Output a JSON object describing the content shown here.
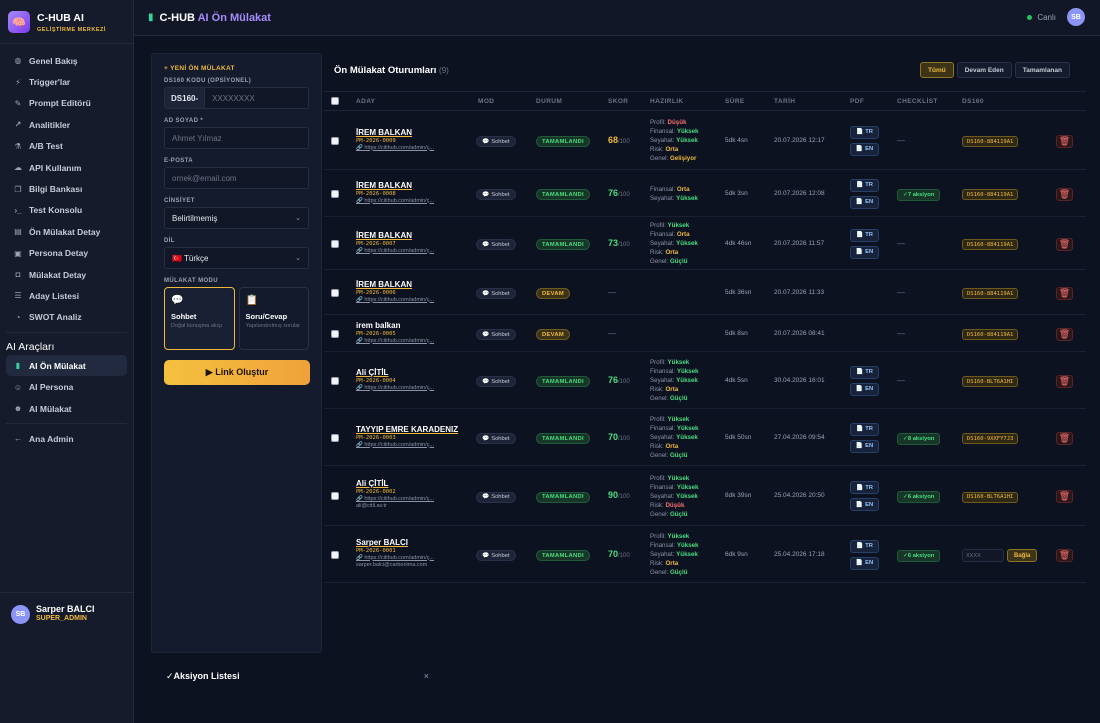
{
  "brand": {
    "title": "C-HUB AI",
    "subtitle": "GELİŞTİRME MERKEZİ"
  },
  "nav": {
    "items": [
      {
        "label": "Genel Bakış",
        "icon": "◍",
        "name": "genel-bakis"
      },
      {
        "label": "Trigger'lar",
        "icon": "⚡",
        "name": "triggerlar"
      },
      {
        "label": "Prompt Editörü",
        "icon": "✎",
        "name": "prompt-editoru"
      },
      {
        "label": "Analitikler",
        "icon": "↗",
        "name": "analitikler"
      },
      {
        "label": "A/B Test",
        "icon": "⚗",
        "name": "ab-test"
      },
      {
        "label": "API Kullanım",
        "icon": "☁",
        "name": "api-kullanim"
      },
      {
        "label": "Bilgi Bankası",
        "icon": "❐",
        "name": "bilgi-bankasi"
      },
      {
        "label": "Test Konsolu",
        "icon": "›_",
        "name": "test-konsolu"
      },
      {
        "label": "Ön Mülakat Detay",
        "icon": "▤",
        "name": "on-mulakat-detay"
      },
      {
        "label": "Persona Detay",
        "icon": "▣",
        "name": "persona-detay"
      },
      {
        "label": "Mülakat Detay",
        "icon": "◘",
        "name": "mulakat-detay"
      },
      {
        "label": "Aday Listesi",
        "icon": "☰",
        "name": "aday-listesi"
      },
      {
        "label": "SWOT Analiz",
        "icon": "◔",
        "name": "swot-analiz"
      }
    ],
    "group_title": "AI Araçları",
    "ai_items": [
      {
        "label": "AI Ön Mülakat",
        "icon": "▮",
        "name": "ai-on-mulakat"
      },
      {
        "label": "AI Persona",
        "icon": "☺",
        "name": "ai-persona"
      },
      {
        "label": "AI Mülakat",
        "icon": "☻",
        "name": "ai-mulakat"
      }
    ],
    "admin_label": "Ana Admin",
    "admin_icon": "←"
  },
  "user": {
    "initials": "SB",
    "name": "Sarper BALCI",
    "role": "SUPER_ADMIN"
  },
  "header": {
    "title_main": "C-HUB",
    "title_accent": " AI Ön Mülakat",
    "live": "Canlı",
    "avatar": "SB"
  },
  "form": {
    "section_title": "+ YENİ ÖN MÜLAKAT",
    "ds160_label": "DS160 KODU (OPSİYONEL)",
    "ds160_prefix": "DS160-",
    "ds160_placeholder": "XXXXXXXX",
    "name_label": "AD SOYAD *",
    "name_placeholder": "Ahmet Yılmaz",
    "email_label": "E-POSTA",
    "email_placeholder": "ornek@email.com",
    "gender_label": "CİNSİYET",
    "gender_value": "Belirtilmemiş",
    "lang_label": "DİL",
    "lang_value": "🇹🇷 Türkçe",
    "mode_label": "MÜLAKAT MODU",
    "mode_chat_title": "Sohbet",
    "mode_chat_desc": "Doğal konuşma akışı",
    "mode_qa_title": "Soru/Cevap",
    "mode_qa_desc": "Yapılandırılmış sorular",
    "submit": "▶ Link Oluştur"
  },
  "sessions": {
    "title": "Ön Mülakat Oturumları",
    "count": "(9)",
    "filters": [
      "Tümü",
      "Devam Eden",
      "Tamamlanan"
    ],
    "columns": [
      "ADAY",
      "MOD",
      "DURUM",
      "SKOR",
      "HAZIRLIK",
      "SÜRE",
      "TARİH",
      "PDF",
      "CHECKLİST",
      "DS160"
    ],
    "rows": [
      {
        "name": "İREM BALKAN",
        "code": "PM-2026-0009",
        "link": "https://citihub.com/admin/ç...",
        "email": "",
        "mode": "Sohbet",
        "status": "TAMAMLANDI",
        "status_kind": "done",
        "score": "68",
        "score_max": "/100",
        "score_color": "#f0b93b",
        "hazirlik": [
          {
            "k": "Profil:",
            "v": "Düşük",
            "c": "#f87171"
          },
          {
            "k": "Finansal:",
            "v": "Yüksek",
            "c": "#4ade80"
          },
          {
            "k": "Seyahat:",
            "v": "Yüksek",
            "c": "#4ade80"
          },
          {
            "k": "Risk:",
            "v": "Orta",
            "c": "#f0b93b"
          },
          {
            "k": "Genel:",
            "v": "Gelişiyor",
            "c": "#f0b93b"
          }
        ],
        "duration": "5dk 4sn",
        "date": "20.07.2026 12:17",
        "pdf": true,
        "checklist": "",
        "ds160": "DS160-884119A1"
      },
      {
        "name": "İREM BALKAN",
        "code": "PM-2026-0008",
        "link": "https://citihub.com/admin/ç...",
        "email": "",
        "mode": "Sohbet",
        "status": "TAMAMLANDI",
        "status_kind": "done",
        "score": "76",
        "score_max": "/100",
        "score_color": "#4ade80",
        "hazirlik": [
          {
            "k": "Finansal:",
            "v": "Orta",
            "c": "#f0b93b"
          },
          {
            "k": "Seyahat:",
            "v": "Yüksek",
            "c": "#4ade80"
          }
        ],
        "duration": "5dk 3sn",
        "date": "20.07.2026 12:08",
        "pdf": true,
        "checklist": "✓7 aksiyon",
        "ds160": "DS160-884119A1"
      },
      {
        "name": "İREM BALKAN",
        "code": "PM-2026-0007",
        "link": "https://citihub.com/admin/ç...",
        "email": "",
        "mode": "Sohbet",
        "status": "TAMAMLANDI",
        "status_kind": "done",
        "score": "73",
        "score_max": "/100",
        "score_color": "#4ade80",
        "hazirlik": [
          {
            "k": "Profil:",
            "v": "Yüksek",
            "c": "#4ade80"
          },
          {
            "k": "Finansal:",
            "v": "Orta",
            "c": "#f0b93b"
          },
          {
            "k": "Seyahat:",
            "v": "Yüksek",
            "c": "#4ade80"
          },
          {
            "k": "Risk:",
            "v": "Orta",
            "c": "#f0b93b"
          },
          {
            "k": "Genel:",
            "v": "Güçlü",
            "c": "#4ade80"
          }
        ],
        "duration": "4dk 46sn",
        "date": "20.07.2026 11:57",
        "pdf": true,
        "checklist": "",
        "ds160": "DS160-884119A1"
      },
      {
        "name": "İREM BALKAN",
        "code": "PM-2026-0006",
        "link": "https://citihub.com/admin/ç...",
        "email": "",
        "mode": "Sohbet",
        "status": "DEVAM",
        "status_kind": "cont",
        "score": "",
        "score_max": "",
        "score_color": "#4ade80",
        "hazirlik": [],
        "duration": "5dk 36sn",
        "date": "20.07.2026 11:33",
        "pdf": false,
        "checklist": "",
        "ds160": "DS160-884119A1"
      },
      {
        "name": "irem balkan",
        "code": "PM-2026-0005",
        "link": "https://citihub.com/admin/ç...",
        "email": "",
        "mode": "Sohbet",
        "status": "DEVAM",
        "status_kind": "cont",
        "score": "",
        "score_max": "",
        "score_color": "#4ade80",
        "hazirlik": [],
        "duration": "5dk 8sn",
        "date": "20.07.2026 08:41",
        "pdf": false,
        "checklist": "",
        "ds160": "DS160-884119A1"
      },
      {
        "name": "Ali ÇİTİL",
        "code": "PM-2026-0004",
        "link": "https://citihub.com/admin/ç...",
        "email": "",
        "mode": "Sohbet",
        "status": "TAMAMLANDI",
        "status_kind": "done",
        "score": "76",
        "score_max": "/100",
        "score_color": "#4ade80",
        "hazirlik": [
          {
            "k": "Profil:",
            "v": "Yüksek",
            "c": "#4ade80"
          },
          {
            "k": "Finansal:",
            "v": "Yüksek",
            "c": "#4ade80"
          },
          {
            "k": "Seyahat:",
            "v": "Yüksek",
            "c": "#4ade80"
          },
          {
            "k": "Risk:",
            "v": "Orta",
            "c": "#f0b93b"
          },
          {
            "k": "Genel:",
            "v": "Güçlü",
            "c": "#4ade80"
          }
        ],
        "duration": "4dk 5sn",
        "date": "30.04.2026 16:01",
        "pdf": true,
        "checklist": "",
        "ds160": "DS160-BLT6A1HI"
      },
      {
        "name": "TAYYIP EMRE KARADENIZ",
        "code": "PM-2026-0003",
        "link": "https://citihub.com/admin/ç...",
        "email": "",
        "mode": "Sohbet",
        "status": "TAMAMLANDI",
        "status_kind": "done",
        "score": "70",
        "score_max": "/100",
        "score_color": "#4ade80",
        "hazirlik": [
          {
            "k": "Profil:",
            "v": "Yüksek",
            "c": "#4ade80"
          },
          {
            "k": "Finansal:",
            "v": "Yüksek",
            "c": "#4ade80"
          },
          {
            "k": "Seyahat:",
            "v": "Yüksek",
            "c": "#4ade80"
          },
          {
            "k": "Risk:",
            "v": "Orta",
            "c": "#f0b93b"
          },
          {
            "k": "Genel:",
            "v": "Güçlü",
            "c": "#4ade80"
          }
        ],
        "duration": "5dk 50sn",
        "date": "27.04.2026 09:54",
        "pdf": true,
        "checklist": "✓8 aksiyon",
        "ds160": "DS160-9XXFY7J3"
      },
      {
        "name": "Ali ÇİTİL",
        "code": "PM-2026-0002",
        "link": "https://citihub.com/admin/ç...",
        "email": "ali@citil.av.tr",
        "mode": "Sohbet",
        "status": "TAMAMLANDI",
        "status_kind": "done",
        "score": "90",
        "score_max": "/100",
        "score_color": "#4ade80",
        "hazirlik": [
          {
            "k": "Profil:",
            "v": "Yüksek",
            "c": "#4ade80"
          },
          {
            "k": "Finansal:",
            "v": "Yüksek",
            "c": "#4ade80"
          },
          {
            "k": "Seyahat:",
            "v": "Yüksek",
            "c": "#4ade80"
          },
          {
            "k": "Risk:",
            "v": "Düşük",
            "c": "#f87171"
          },
          {
            "k": "Genel:",
            "v": "Güçlü",
            "c": "#4ade80"
          }
        ],
        "duration": "8dk 39sn",
        "date": "25.04.2026 20:50",
        "pdf": true,
        "checklist": "✓6 aksiyon",
        "ds160": "DS160-BLT6A1HI"
      },
      {
        "name": "Sarper BALCI",
        "code": "PM-2026-0001",
        "link": "https://citihub.com/admin/ç...",
        "email": "sarper.balci@carbonima.com",
        "mode": "Sohbet",
        "status": "TAMAMLANDI",
        "status_kind": "done",
        "score": "70",
        "score_max": "/100",
        "score_color": "#4ade80",
        "hazirlik": [
          {
            "k": "Profil:",
            "v": "Yüksek",
            "c": "#4ade80"
          },
          {
            "k": "Finansal:",
            "v": "Yüksek",
            "c": "#4ade80"
          },
          {
            "k": "Seyahat:",
            "v": "Yüksek",
            "c": "#4ade80"
          },
          {
            "k": "Risk:",
            "v": "Orta",
            "c": "#f0b93b"
          },
          {
            "k": "Genel:",
            "v": "Güçlü",
            "c": "#4ade80"
          }
        ],
        "duration": "6dk 9sn",
        "date": "25.04.2026 17:18",
        "pdf": true,
        "checklist": "✓6 aksiyon",
        "ds160": "",
        "ds160_placeholder": "XXXX",
        "ds160_link": "Bağla"
      }
    ],
    "pdf_labels": [
      "TR",
      "EN"
    ],
    "dash": "—"
  },
  "action_list": {
    "title": "✓Aksiyon Listesi",
    "close": "×"
  }
}
